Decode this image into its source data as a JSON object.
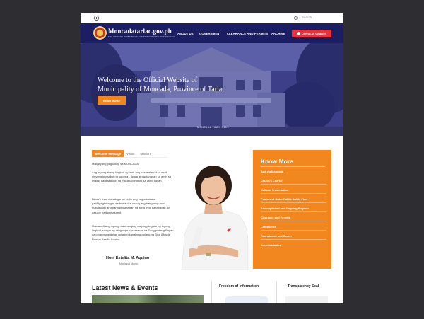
{
  "topbar": {
    "access_icon": "accessibility-icon",
    "search_placeholder": "Search"
  },
  "nav": {
    "brand": "Moncadatarlac.gov.ph",
    "brand_sub": "THE OFFICIAL WEBSITE OF THE MUNICIPALITY OF MONCADA",
    "items": [
      "ABOUT US",
      "GOVERNMENT",
      "CLEARANCE AND PERMITS",
      "ARCHIVE"
    ],
    "covid_label": "COVID-19 Updates"
  },
  "hero": {
    "line1": "Welcome to the Official Website of",
    "line2": "Municipality of Moncada, Province of Tarlac",
    "button": "READ MORE",
    "building_sign": "MONCADA TOWN HALL"
  },
  "welcome": {
    "tabs": [
      "Welcome Message",
      "Vision",
      "Mission"
    ],
    "greeting": "Maligayang pagdating sa MONCADA!",
    "p1": "Ang inyong abang lingkod ay taos-ang pasasalamat sa mulli ninyong ipinaabot na suporta , tiwala at pagtanggap sa amin sa muling pagkakaloob na makapaglingkod sa ating bayan.",
    "p2": "Nawa'y mas mapalaganap natin ang pagkakaisa at pakikipagtulungan sa bawat isa upang ang hangaring mas matugunan ang pangangailangan ng ating mga kababayan ay patuloy nating makamit.",
    "p3": "Malawakit ang inyong matahanging maipagyangako ng inyong lingkod, sampu ng ating mga kasamahan sa Sangguniang Bayan na pinangunguluhan ng ating kapatang-gulang na Bise Alkalde Ramon Basilio Aquino.",
    "mayor_name": "Hon. Estelita M. Aquino",
    "mayor_role": "Municipal Mayor"
  },
  "know_more": {
    "title": "Know More",
    "items": [
      "Awit ng Moncada",
      "Citizen's Charter",
      "Cultural Presentation",
      "Peace and Order Public Safety Plan",
      "Accomplished and Ongoing Projects",
      "Clearance and Permits",
      "Compliance",
      "Recruitment and Career",
      "Downloadables"
    ]
  },
  "bottom": {
    "news_title": "Latest News & Events",
    "foi_title": "Freedom of Information",
    "transparency_title": "Transparency Seal"
  },
  "colors": {
    "navy": "#1c1e63",
    "orange": "#f2861f",
    "covid_red": "#e4323e",
    "background": "#2e2e32"
  }
}
